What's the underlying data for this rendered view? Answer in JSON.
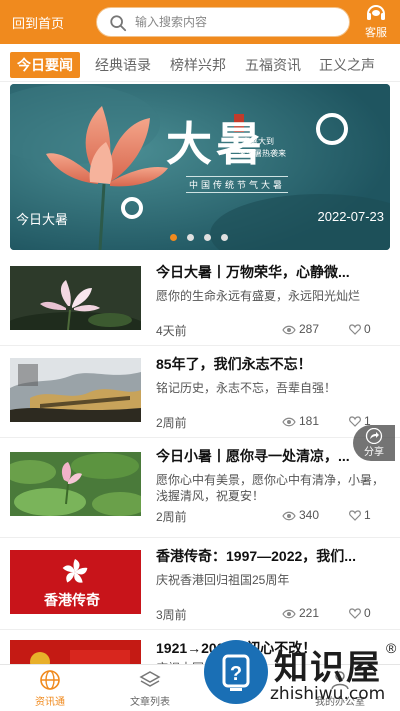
{
  "header": {
    "home_label": "回到首页",
    "search_placeholder": "输入搜索内容",
    "service_label": "客服",
    "accent_color": "#f08a1e"
  },
  "tabs": [
    {
      "label": "今日要闻",
      "active": true
    },
    {
      "label": "经典语录",
      "active": false
    },
    {
      "label": "榜样兴邦",
      "active": false
    },
    {
      "label": "五福资讯",
      "active": false
    },
    {
      "label": "正义之声",
      "active": false
    }
  ],
  "banner": {
    "title_big": "大暑",
    "subtitle_line1": "大暑大到",
    "subtitle_line2": "滚滚暑热袭来",
    "tag": "中国传统节气大暑",
    "caption": "今日大暑",
    "date": "2022-07-23",
    "slide_count": 4,
    "active_slide": 0
  },
  "news": [
    {
      "title": "今日大暑丨万物荣华，心静微...",
      "desc": "愿你的生命永远有盛夏，永远阳光灿烂",
      "time": "4天前",
      "views": "287",
      "likes": "0",
      "thumb": "lotus"
    },
    {
      "title": "85年了，我们永志不忘！",
      "desc": "铭记历史，永志不忘，吾辈自强！",
      "time": "2周前",
      "views": "181",
      "likes": "1",
      "thumb": "great-wall"
    },
    {
      "title": "今日小暑丨愿你寻一处清凉，...",
      "desc": "愿你心中有美景，愿你心中有清净，小暑，浅握清风，祝夏安！",
      "time": "2周前",
      "views": "340",
      "likes": "1",
      "thumb": "lotus-leaves"
    },
    {
      "title": "香港传奇：1997—2022，我们...",
      "desc": "庆祝香港回归祖国25周年",
      "time": "3周前",
      "views": "221",
      "likes": "0",
      "thumb": "hong-kong",
      "thumb_text": "香港传奇"
    },
    {
      "title": "1921→2022，初心不改！",
      "desc": "庆祝中国",
      "time": "",
      "views": "",
      "likes": "",
      "thumb": "party"
    }
  ],
  "share": {
    "label": "分享"
  },
  "bottom_nav": [
    {
      "label": "资讯通",
      "icon": "globe-icon",
      "active": true
    },
    {
      "label": "文章列表",
      "icon": "layers-icon",
      "active": false
    },
    {
      "label": "",
      "icon": "center-icon",
      "active": false
    },
    {
      "label": "我的办公室",
      "icon": "user-icon",
      "active": false
    }
  ],
  "watermark": {
    "text": "知识屋",
    "url": "zhishiwu.com",
    "registered": "®"
  }
}
